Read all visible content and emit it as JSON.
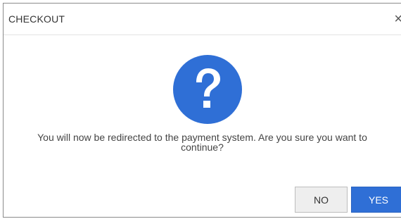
{
  "dialog": {
    "title": "CHECKOUT",
    "close_label": "×",
    "icon": "question-circle-icon",
    "message": "You will now be redirected to the payment system. Are you sure you want to continue?",
    "buttons": {
      "no_label": "NO",
      "yes_label": "YES"
    }
  },
  "colors": {
    "accent": "#2f6fd6",
    "icon": "#2f6fd6",
    "no_button_bg": "#eeeeee"
  }
}
